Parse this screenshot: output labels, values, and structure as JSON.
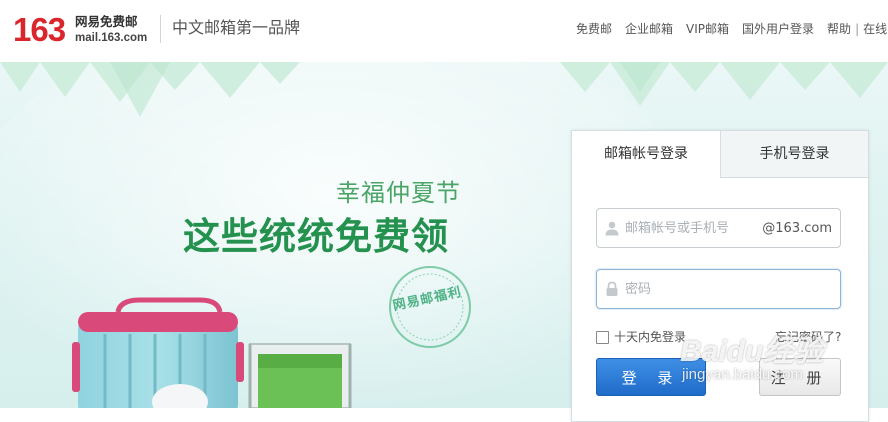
{
  "header": {
    "logo_number": "163",
    "logo_cn": "网易免费邮",
    "logo_url": "mail.163.com",
    "slogan": "中文邮箱第一品牌",
    "nav": [
      "免费邮",
      "企业邮箱",
      "VIP邮箱",
      "国外用户登录",
      "帮助",
      "|",
      "在线"
    ]
  },
  "banner": {
    "subtitle": "幸福仲夏节",
    "title": "这些统统免费领",
    "stamp": "网易邮福利"
  },
  "login": {
    "tabs": [
      "邮箱帐号登录",
      "手机号登录"
    ],
    "username_placeholder": "邮箱帐号或手机号",
    "domain_suffix": "@163.com",
    "password_placeholder": "密码",
    "remember_label": "十天内免登录",
    "forgot_label": "忘记密码了?",
    "login_button": "登 录",
    "register_button": "注 册"
  },
  "watermark": {
    "brand": "Baidu经验",
    "url": "jingyan.baidu.com"
  },
  "colors": {
    "brand_red": "#d9262d",
    "promo_green": "#25914f",
    "login_blue": "#2a79d6"
  },
  "icons": [
    "user-icon",
    "lock-icon",
    "checkbox"
  ]
}
